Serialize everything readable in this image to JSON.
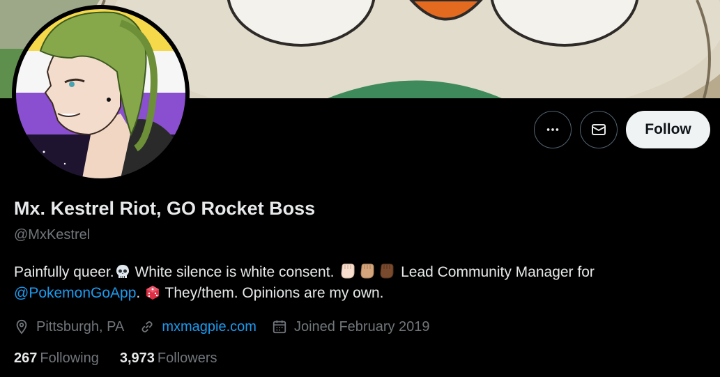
{
  "profile": {
    "display_name": "Mx. Kestrel Riot, GO Rocket Boss",
    "handle": "@MxKestrel",
    "bio": {
      "part1": "Painfully queer.",
      "part2": " White silence is white consent. ",
      "part3": " Lead Community Manager for",
      "mention": "@PokemonGoApp",
      "part4": ". ",
      "part5": " They/them. Opinions are my own."
    },
    "location": "Pittsburgh, PA",
    "website": "mxmagpie.com",
    "joined": "Joined February 2019",
    "following_count": "267",
    "following_label": "Following",
    "followers_count": "3,973",
    "followers_label": "Followers"
  },
  "actions": {
    "follow_label": "Follow",
    "more_icon": "more-horizontal-icon",
    "message_icon": "envelope-icon"
  },
  "colors": {
    "background": "#000000",
    "text_primary": "#e7e9ea",
    "text_secondary": "#71767b",
    "link": "#1d9bf0",
    "follow_button_bg": "#eff3f4"
  }
}
